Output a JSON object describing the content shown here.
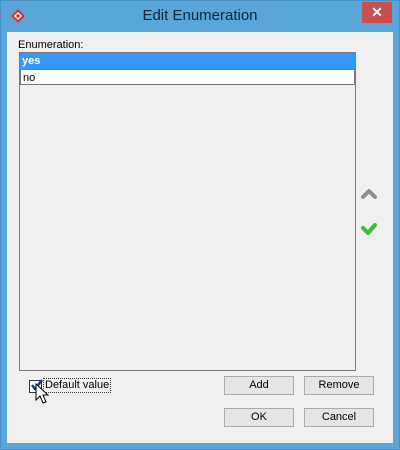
{
  "window": {
    "title": "Edit Enumeration",
    "app_icon": "visual-paradigm-icon",
    "close_glyph": "✕"
  },
  "enumeration": {
    "label": "Enumeration:",
    "items": [
      {
        "label": "yes",
        "selected": true
      },
      {
        "label": "no",
        "selected": false
      }
    ]
  },
  "side_buttons": {
    "move_up_icon": "arrow-up-icon",
    "confirm_icon": "check-icon"
  },
  "default_value": {
    "label": "Default value",
    "checked": true
  },
  "buttons": {
    "add": "Add",
    "remove": "Remove",
    "ok": "OK",
    "cancel": "Cancel"
  },
  "colors": {
    "titlebar": "#5aa5da",
    "selection": "#3399ff",
    "close": "#c75050",
    "confirm": "#3cb83c"
  }
}
